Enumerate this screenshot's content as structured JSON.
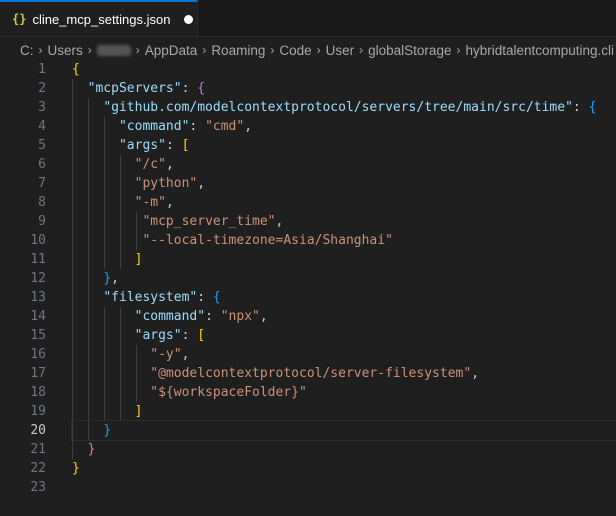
{
  "tab": {
    "icon": "{}",
    "label": "cline_mcp_settings.json"
  },
  "breadcrumb": [
    "C:",
    "Users",
    "",
    "AppData",
    "Roaming",
    "Code",
    "User",
    "globalStorage",
    "hybridtalentcomputing.cli"
  ],
  "line_numbers": [
    "1",
    "2",
    "3",
    "4",
    "5",
    "6",
    "7",
    "8",
    "9",
    "10",
    "11",
    "12",
    "13",
    "14",
    "15",
    "16",
    "17",
    "18",
    "19",
    "20",
    "21",
    "22",
    "23"
  ],
  "code": {
    "l1": {
      "b": "{"
    },
    "l2": {
      "k": "\"mcpServers\"",
      "c": ": ",
      "b": "{"
    },
    "l3": {
      "k": "\"github.com/modelcontextprotocol/servers/tree/main/src/time\"",
      "c": ": ",
      "b": "{"
    },
    "l4": {
      "k": "\"command\"",
      "c": ": ",
      "s": "\"cmd\"",
      "e": ","
    },
    "l5": {
      "k": "\"args\"",
      "c": ": ",
      "b": "["
    },
    "l6": {
      "s": "\"/c\"",
      "e": ","
    },
    "l7": {
      "s": "\"python\"",
      "e": ","
    },
    "l8": {
      "s": "\"-m\"",
      "e": ","
    },
    "l9": {
      "s": "\"mcp_server_time\"",
      "e": ","
    },
    "l10": {
      "s": "\"--local-timezone=Asia/Shanghai\""
    },
    "l11": {
      "b": "]"
    },
    "l12": {
      "b": "}",
      "e": ","
    },
    "l13": {
      "k": "\"filesystem\"",
      "c": ": ",
      "b": "{"
    },
    "l14": {
      "k": "\"command\"",
      "c": ": ",
      "s": "\"npx\"",
      "e": ","
    },
    "l15": {
      "k": "\"args\"",
      "c": ": ",
      "b": "["
    },
    "l16": {
      "s": "\"-y\"",
      "e": ","
    },
    "l17": {
      "s": "\"@modelcontextprotocol/server-filesystem\"",
      "e": ","
    },
    "l18": {
      "s": "\"${workspaceFolder}\""
    },
    "l19": {
      "b": "]"
    },
    "l20": {
      "b": "}"
    },
    "l21": {
      "b": "}"
    },
    "l22": {
      "b": "}"
    }
  }
}
